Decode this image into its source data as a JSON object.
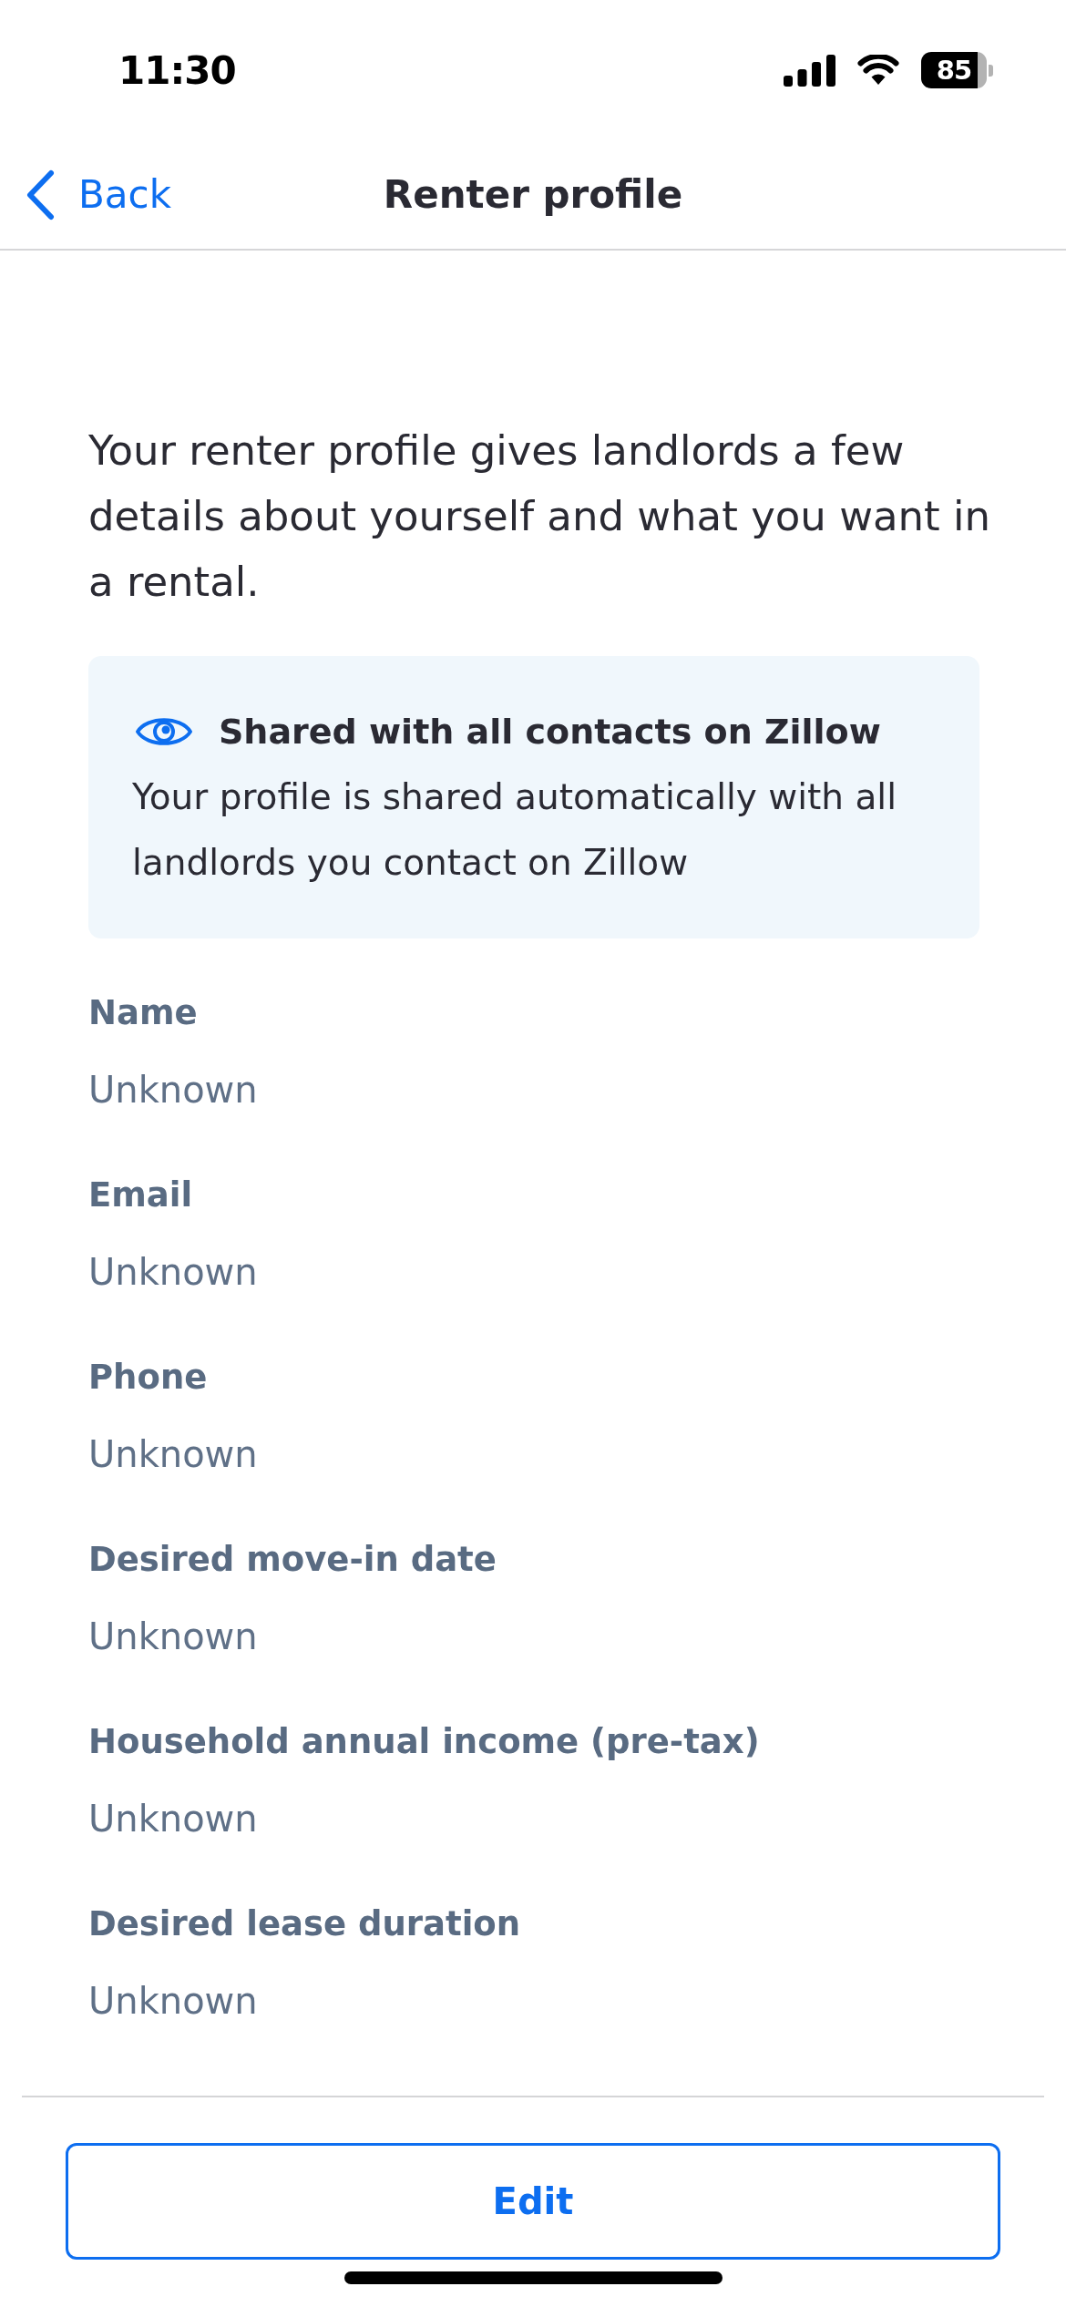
{
  "status_bar": {
    "time": "11:30",
    "battery": "85"
  },
  "nav": {
    "back": "Back",
    "title": "Renter profile"
  },
  "intro": "Your renter profile gives landlords a few details about yourself and what you want in a rental.",
  "notice": {
    "title": "Shared with all contacts on Zillow",
    "body": "Your profile is shared automatically with all landlords you contact on Zillow"
  },
  "fields": [
    {
      "label": "Name",
      "value": "Unknown"
    },
    {
      "label": "Email",
      "value": "Unknown"
    },
    {
      "label": "Phone",
      "value": "Unknown"
    },
    {
      "label": "Desired move-in date",
      "value": "Unknown"
    },
    {
      "label": "Household annual income (pre-tax)",
      "value": "Unknown"
    },
    {
      "label": "Desired lease duration",
      "value": "Unknown"
    }
  ],
  "edit_button": "Edit"
}
